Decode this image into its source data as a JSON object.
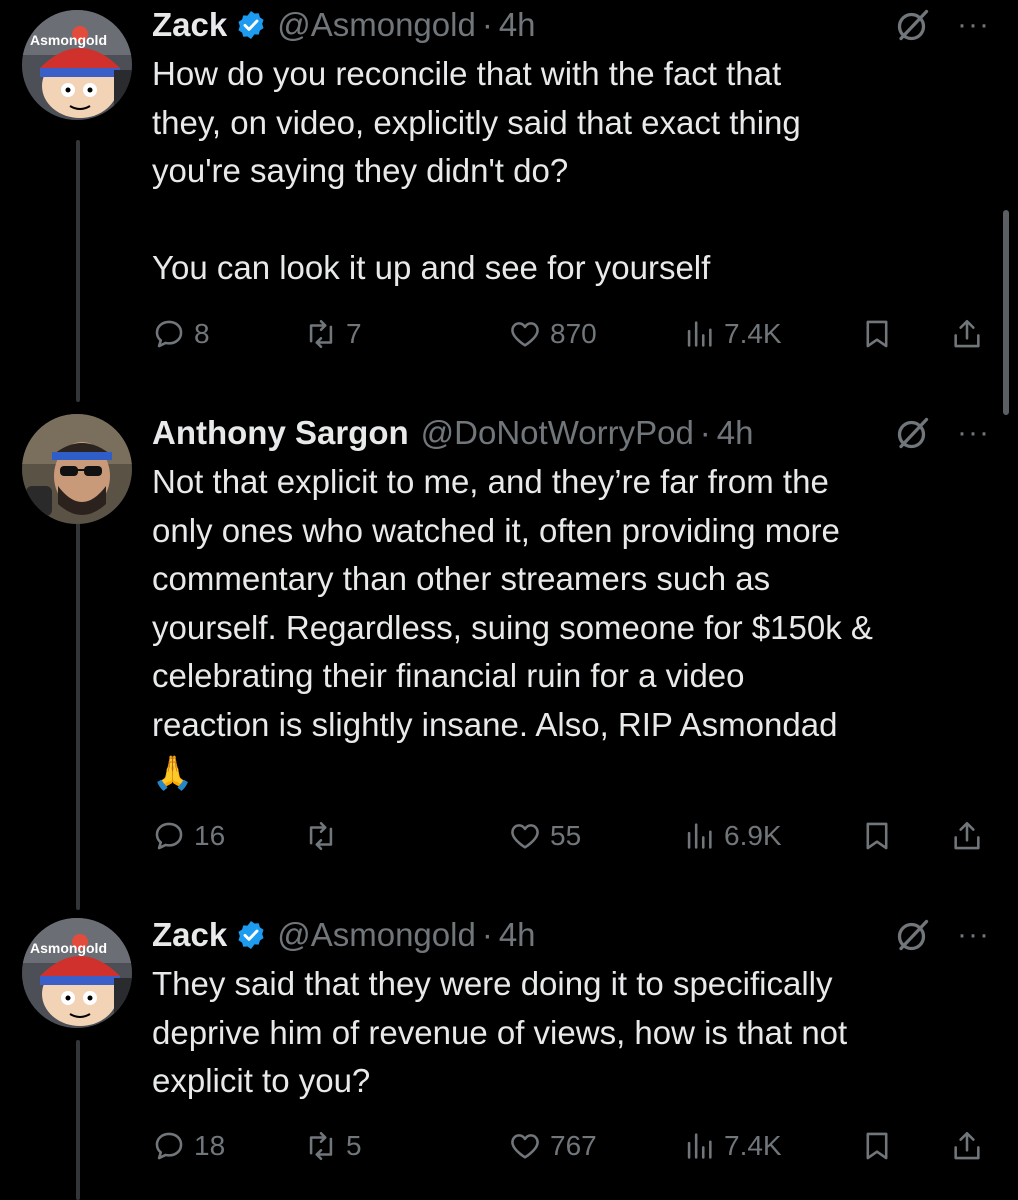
{
  "tweets": [
    {
      "display_name": "Zack",
      "verified": true,
      "handle": "@Asmongold",
      "separator": "·",
      "time": "4h",
      "avatar_label": "Asmongold",
      "text": "How do you reconcile that with the fact that\nthey, on video, explicitly said that exact thing\nyou're saying they didn't do?\n\nYou can look it up and see for yourself",
      "replies": "8",
      "retweets": "7",
      "likes": "870",
      "views": "7.4K"
    },
    {
      "display_name": "Anthony Sargon",
      "verified": false,
      "handle": "@DoNotWorryPod",
      "separator": "·",
      "time": "4h",
      "avatar_label": "",
      "text": "Not that explicit to me, and they’re far from the\nonly ones who watched it, often providing more\ncommentary than other streamers such as\nyourself. Regardless, suing someone for $150k &\ncelebrating their financial ruin for a video\nreaction is slightly insane. Also, RIP Asmondad\n🙏",
      "replies": "16",
      "retweets": "",
      "likes": "55",
      "views": "6.9K"
    },
    {
      "display_name": "Zack",
      "verified": true,
      "handle": "@Asmongold",
      "separator": "·",
      "time": "4h",
      "avatar_label": "Asmongold",
      "text": "They said that they were doing it to specifically\ndeprive him of revenue of views, how is that not\nexplicit to you?",
      "replies": "18",
      "retweets": "5",
      "likes": "767",
      "views": "7.4K"
    }
  ],
  "icons": {
    "reply": "reply-icon",
    "retweet": "retweet-icon",
    "like": "heart-icon",
    "views": "views-icon",
    "bookmark": "bookmark-icon",
    "share": "share-icon",
    "grok": "grok-icon",
    "more": "more-icon",
    "verified": "verified-icon"
  },
  "colors": {
    "background": "#000000",
    "text": "#e7e9ea",
    "secondary": "#71767b",
    "verified": "#1d9bf0"
  },
  "more_glyph": "···"
}
